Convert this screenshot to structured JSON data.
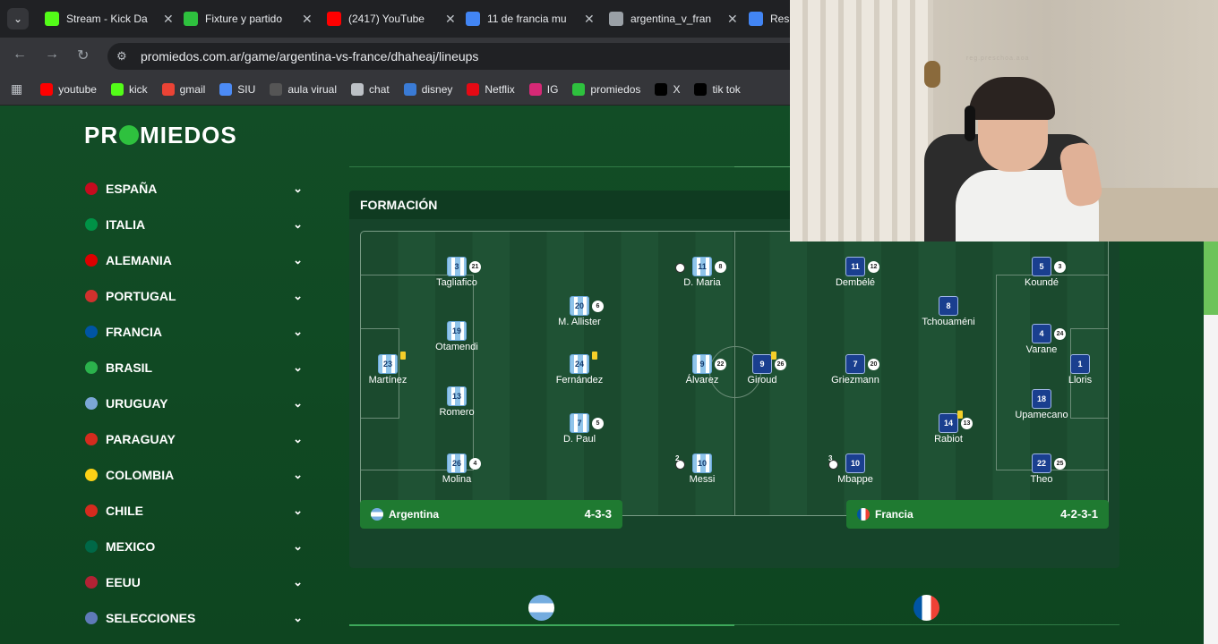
{
  "browser": {
    "tabs": [
      {
        "label": "Stream - Kick Da",
        "icon": "kick-icon",
        "color": "#53fc18"
      },
      {
        "label": "Fixture y partido",
        "icon": "promiedos-icon",
        "color": "#2ec13e"
      },
      {
        "label": "(2417) YouTube",
        "icon": "youtube-icon",
        "color": "#ff0000"
      },
      {
        "label": "11 de francia mu",
        "icon": "google-icon",
        "color": "#4285f4"
      },
      {
        "label": "argentina_v_fran",
        "icon": "globe-icon",
        "color": "#9aa0a6"
      },
      {
        "label": "Resu",
        "icon": "google-icon",
        "color": "#4285f4"
      }
    ],
    "url": "promiedos.com.ar/game/argentina-vs-france/dhaheaj/lineups",
    "bookmarks": [
      {
        "label": "youtube",
        "icon": "youtube-icon",
        "color": "#ff0000"
      },
      {
        "label": "kick",
        "icon": "kick-icon",
        "color": "#53fc18"
      },
      {
        "label": "gmail",
        "icon": "gmail-icon",
        "color": "#ea4335"
      },
      {
        "label": "SIU",
        "icon": "siu-icon",
        "color": "#4c8bf5"
      },
      {
        "label": "aula virual",
        "icon": "aula-icon",
        "color": "#555555"
      },
      {
        "label": "chat",
        "icon": "chatgpt-icon",
        "color": "#bdc1c6"
      },
      {
        "label": "disney",
        "icon": "disney-icon",
        "color": "#3a7bd5"
      },
      {
        "label": "Netflix",
        "icon": "netflix-icon",
        "color": "#e50914"
      },
      {
        "label": "IG",
        "icon": "instagram-icon",
        "color": "#d62976"
      },
      {
        "label": "promiedos",
        "icon": "promiedos-icon",
        "color": "#2ec13e"
      },
      {
        "label": "X",
        "icon": "x-icon",
        "color": "#000000"
      },
      {
        "label": "tik tok",
        "icon": "tiktok-icon",
        "color": "#000000"
      }
    ]
  },
  "site": {
    "logo_left": "PR",
    "logo_right": "MIEDOS",
    "leagues": [
      {
        "label": "ESPAÑA",
        "flag": "#c60b1e"
      },
      {
        "label": "ITALIA",
        "flag": "#009246"
      },
      {
        "label": "ALEMANIA",
        "flag": "#dd0000"
      },
      {
        "label": "PORTUGAL",
        "flag": "#d0312d"
      },
      {
        "label": "FRANCIA",
        "flag": "#0055a4"
      },
      {
        "label": "BRASIL",
        "flag": "#2bb24c"
      },
      {
        "label": "URUGUAY",
        "flag": "#7ba7d6"
      },
      {
        "label": "PARAGUAY",
        "flag": "#d52b1e"
      },
      {
        "label": "COLOMBIA",
        "flag": "#fcd116"
      },
      {
        "label": "CHILE",
        "flag": "#d52b1e"
      },
      {
        "label": "MEXICO",
        "flag": "#006847"
      },
      {
        "label": "EEUU",
        "flag": "#b22234"
      },
      {
        "label": "SELECCIONES",
        "flag": "#5f7ab8"
      }
    ]
  },
  "formation": {
    "title": "FORMACIÓN",
    "home": {
      "name": "Argentina",
      "system": "4-3-3"
    },
    "away": {
      "name": "Francia",
      "system": "4-2-3-1"
    },
    "players": [
      {
        "team": "arg",
        "num": "23",
        "name": "Martínez",
        "card": true
      },
      {
        "team": "arg",
        "num": "3",
        "name": "Tagliafico",
        "sub": "21"
      },
      {
        "team": "arg",
        "num": "19",
        "name": "Otamendi"
      },
      {
        "team": "arg",
        "num": "13",
        "name": "Romero"
      },
      {
        "team": "arg",
        "num": "26",
        "name": "Molina",
        "sub": "4"
      },
      {
        "team": "arg",
        "num": "20",
        "name": "M. Allister",
        "sub": "6"
      },
      {
        "team": "arg",
        "num": "24",
        "name": "Fernández",
        "card": true
      },
      {
        "team": "arg",
        "num": "7",
        "name": "D. Paul",
        "sub": "5"
      },
      {
        "team": "arg",
        "num": "11",
        "name": "D. Maria",
        "sub": "8",
        "goals": ""
      },
      {
        "team": "arg",
        "num": "9",
        "name": "Álvarez",
        "sub": "22"
      },
      {
        "team": "arg",
        "num": "10",
        "name": "Messi",
        "goals": "2"
      },
      {
        "team": "fra",
        "num": "9",
        "name": "Giroud",
        "sub": "26",
        "card": true
      },
      {
        "team": "fra",
        "num": "11",
        "name": "Dembélé",
        "sub": "12"
      },
      {
        "team": "fra",
        "num": "7",
        "name": "Griezmann",
        "sub": "20"
      },
      {
        "team": "fra",
        "num": "10",
        "name": "Mbappe",
        "goals": "3"
      },
      {
        "team": "fra",
        "num": "8",
        "name": "Tchouaméni"
      },
      {
        "team": "fra",
        "num": "14",
        "name": "Rabiot",
        "sub": "13",
        "card": true
      },
      {
        "team": "fra",
        "num": "5",
        "name": "Koundé",
        "sub": "3"
      },
      {
        "team": "fra",
        "num": "4",
        "name": "Varane",
        "sub": "24"
      },
      {
        "team": "fra",
        "num": "18",
        "name": "Upamecano"
      },
      {
        "team": "fra",
        "num": "22",
        "name": "Theo",
        "sub": "25"
      },
      {
        "team": "fra",
        "num": "1",
        "name": "Lloris"
      }
    ]
  },
  "webcam": {
    "wall_text": "reg.preschoa.aoa"
  }
}
